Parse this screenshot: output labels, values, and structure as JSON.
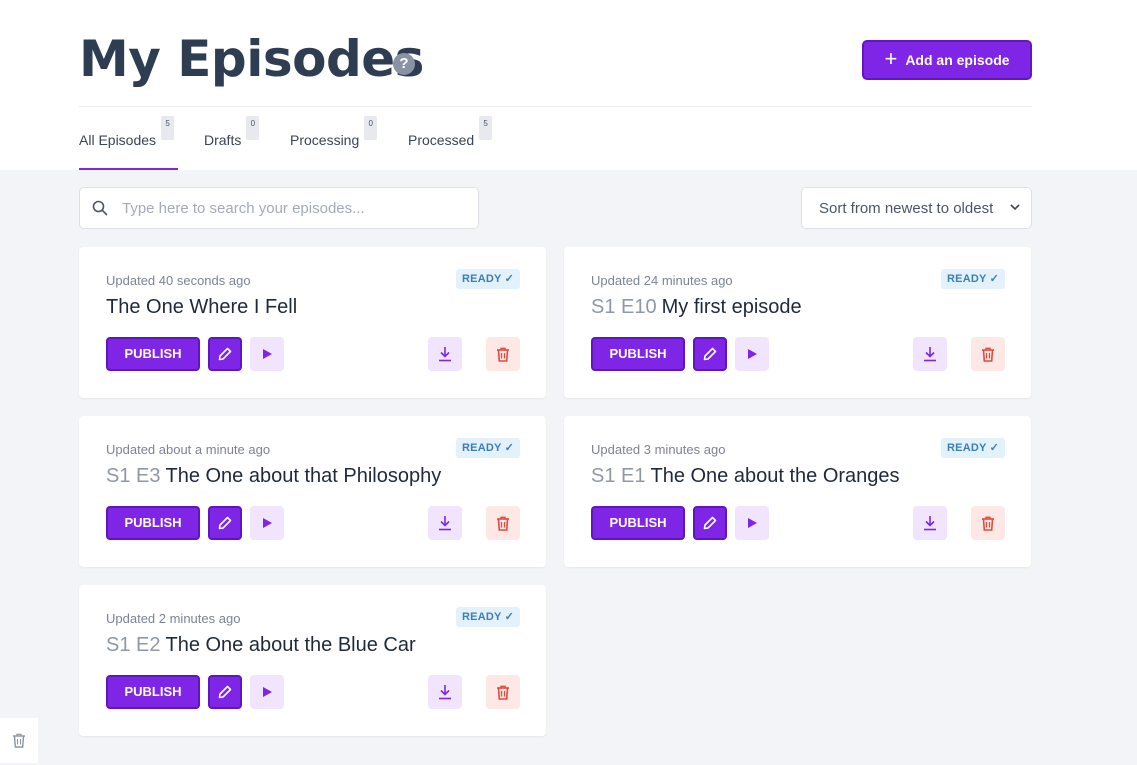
{
  "header": {
    "title": "My Episodes",
    "help_icon": "?",
    "add_button_label": "Add an episode",
    "add_icon": "+"
  },
  "tabs": [
    {
      "label": "All Episodes",
      "count": "5",
      "active": true
    },
    {
      "label": "Drafts",
      "count": "0"
    },
    {
      "label": "Processing",
      "count": "0"
    },
    {
      "label": "Processed",
      "count": "5"
    }
  ],
  "search": {
    "placeholder": "Type here to search your episodes..."
  },
  "sort": {
    "selected": "Sort from newest to oldest",
    "chevron": "⌄"
  },
  "episodes": [
    {
      "updated": "Updated 40 seconds ago",
      "status": "READY ✓",
      "prefix": "",
      "title": "The One Where I Fell",
      "publish_label": "PUBLISH"
    },
    {
      "updated": "Updated 24 minutes ago",
      "status": "READY ✓",
      "prefix": "S1 E10",
      "title": "My first episode",
      "publish_label": "PUBLISH"
    },
    {
      "updated": "Updated about a minute ago",
      "status": "READY ✓",
      "prefix": "S1 E3",
      "title": "The One about that Philosophy",
      "publish_label": "PUBLISH"
    },
    {
      "updated": "Updated 3 minutes ago",
      "status": "READY ✓",
      "prefix": "S1 E1",
      "title": "The One about the Oranges",
      "publish_label": "PUBLISH"
    },
    {
      "updated": "Updated 2 minutes ago",
      "status": "READY ✓",
      "prefix": "S1 E2",
      "title": "The One about the Blue Car",
      "publish_label": "PUBLISH"
    }
  ],
  "colors": {
    "accent": "#7f25e6",
    "accent_light": "#f0e5fd",
    "danger_light": "#fde8e6",
    "ready_bg": "#e3f1fb",
    "ready_text": "#3a7fb5",
    "background": "#f3f4f7"
  },
  "icons": {
    "search": "search-icon",
    "edit": "pencil-icon",
    "play": "play-icon",
    "download": "download-icon",
    "delete": "trash-icon"
  }
}
